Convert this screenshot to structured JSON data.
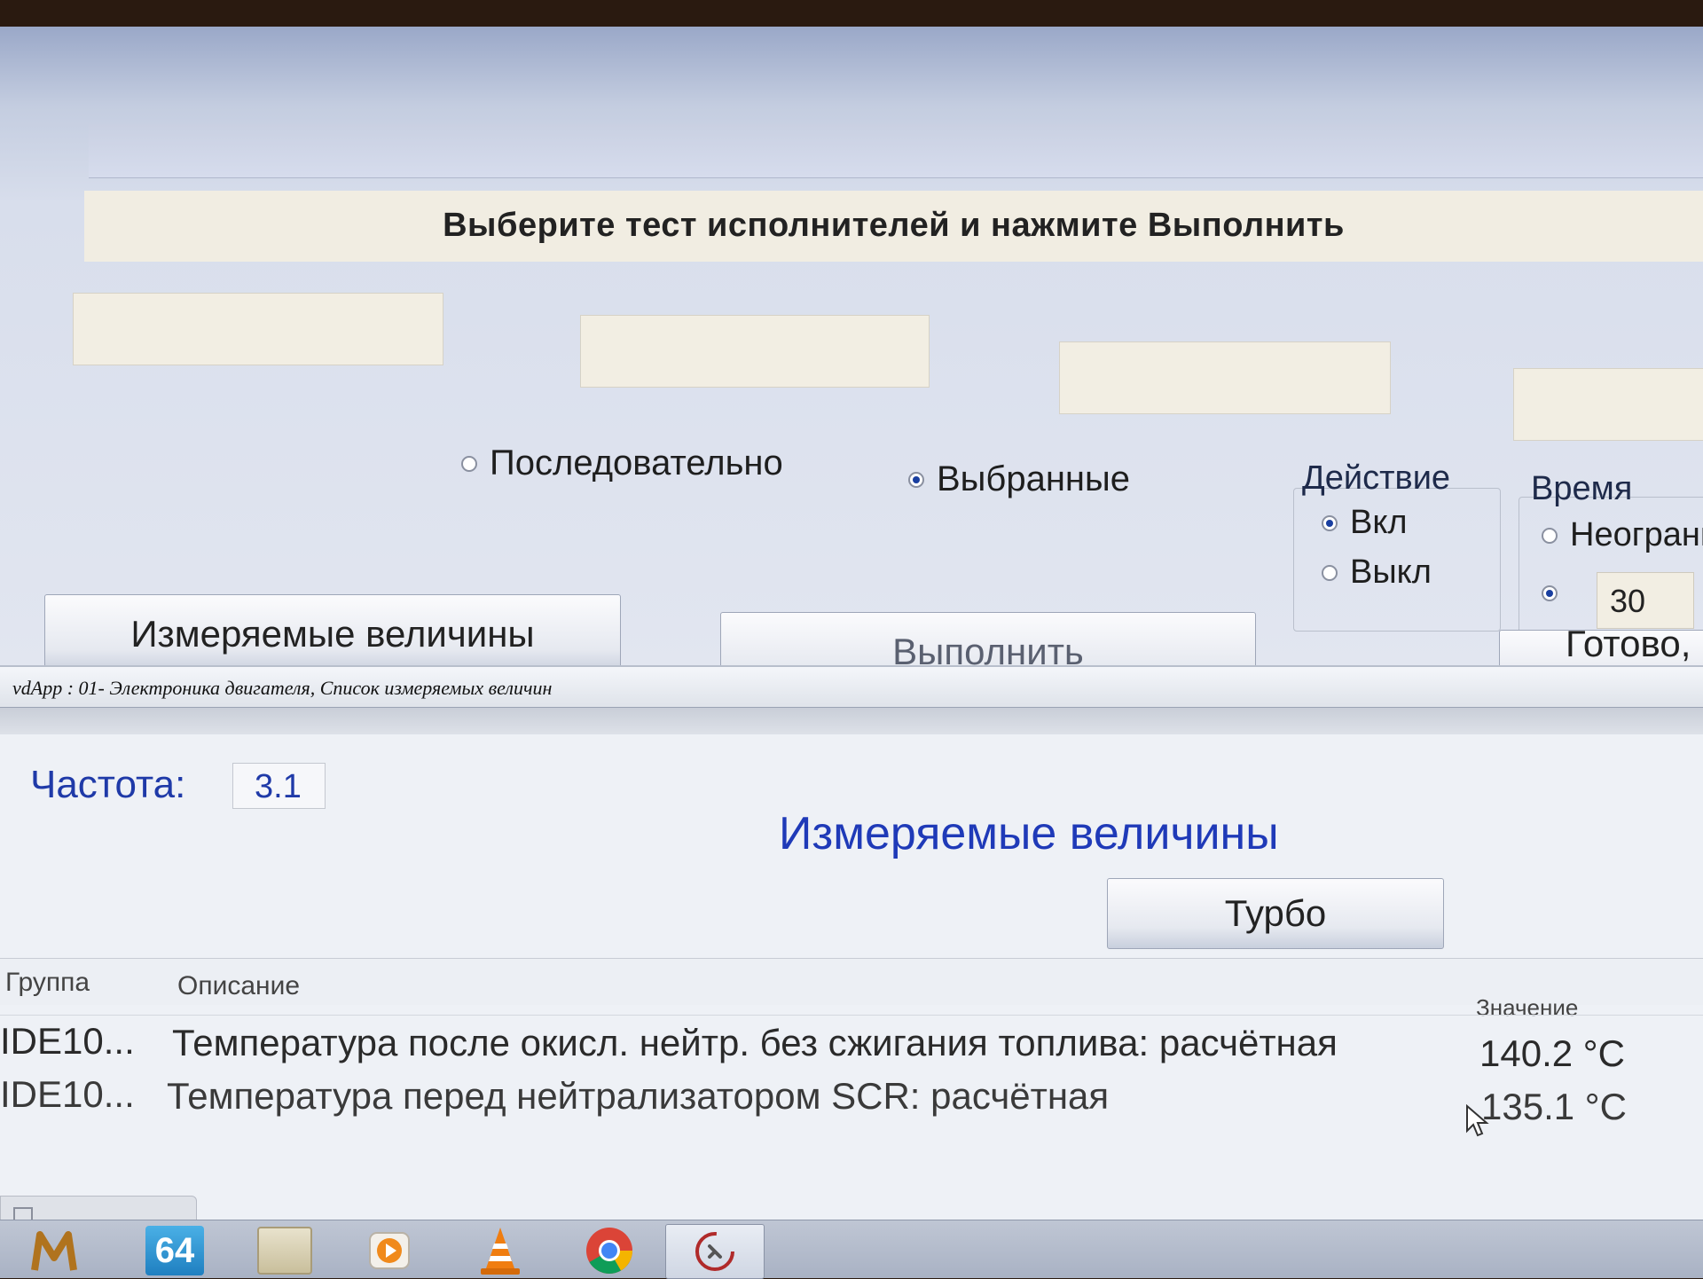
{
  "actuator_test": {
    "instruction": "Выберите тест исполнителей и нажмите Выполнить",
    "mode_sequential": "Последовательно",
    "mode_selected": "Выбранные",
    "action_title": "Действие",
    "action_on": "Вкл",
    "action_off": "Выкл",
    "time_title": "Время",
    "time_unlimited": "Неограни",
    "time_value": "30",
    "measured_values_button": "Измеряемые величины",
    "execute_button": "Выполнить",
    "done_button": "Готово, Н"
  },
  "measured_window": {
    "title": "vdApp : 01- Электроника двигателя,  Список измеряемых величин",
    "frequency_label": "Частота:",
    "frequency_value": "3.1",
    "section_title": "Измеряемые величины",
    "turbo_button": "Турбо",
    "columns": {
      "group": "Группа",
      "description": "Описание",
      "value": "Значение"
    },
    "rows": [
      {
        "group": "IDE10...",
        "description": "Температура после окисл. нейтр. без сжигания топлива: расчётная",
        "value": "140.2 °C"
      },
      {
        "group": "IDE10...",
        "description": "Температура перед нейтрализатором SCR: расчётная",
        "value": "135.1 °C"
      }
    ]
  },
  "taskbar": {
    "items": [
      "m-app-icon",
      "64-app-icon",
      "card-app-icon",
      "media-player-icon",
      "vlc-icon",
      "chrome-icon",
      "diagnostic-app-icon"
    ],
    "app64_label": "64"
  }
}
